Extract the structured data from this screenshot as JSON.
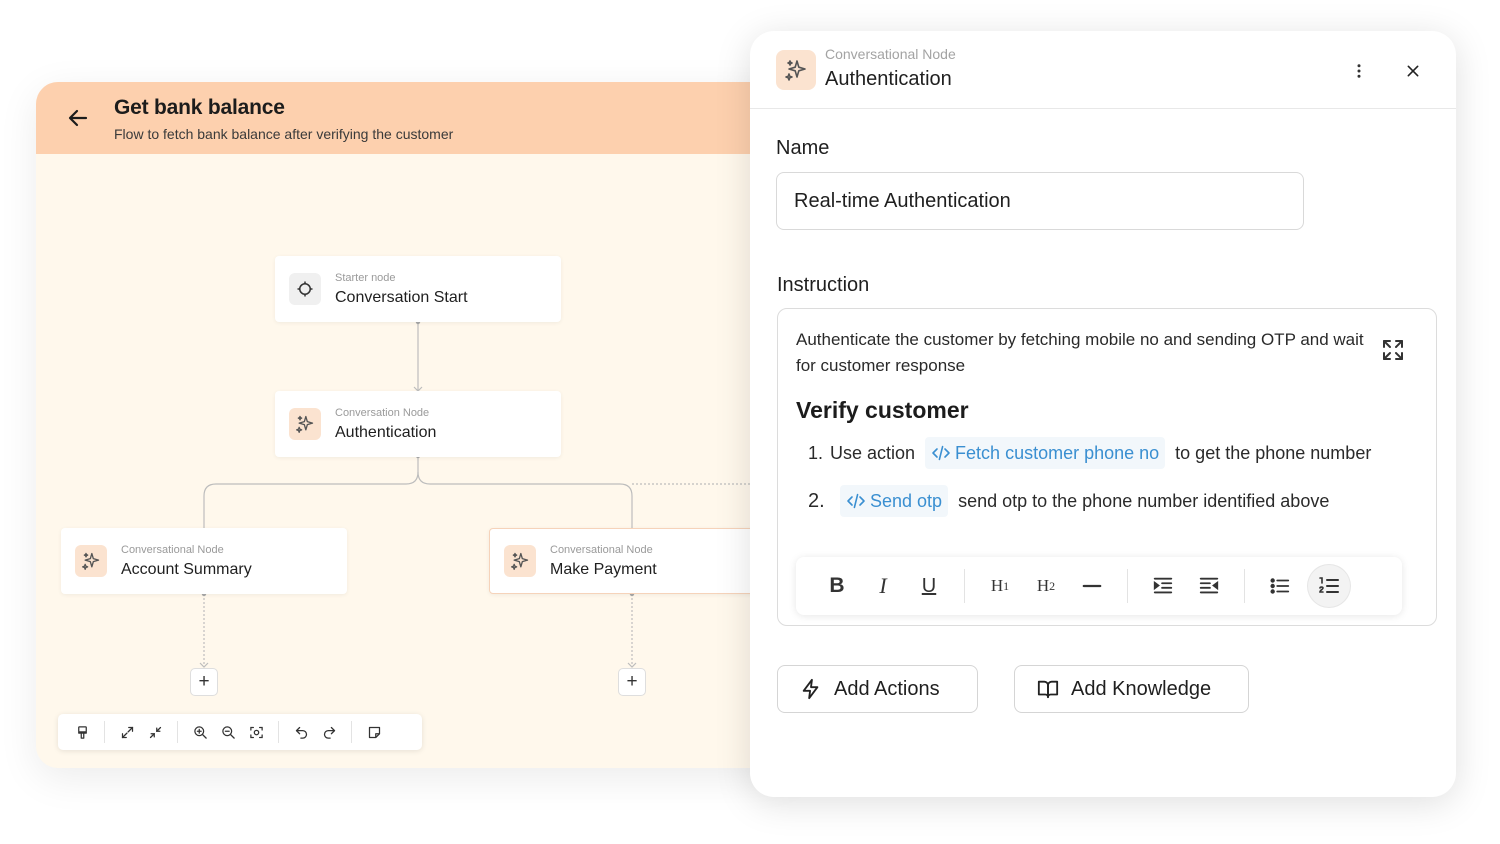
{
  "flow": {
    "title": "Get bank balance",
    "subtitle": "Flow to fetch bank balance after verifying the customer",
    "nodes": {
      "start": {
        "kind": "Starter node",
        "label": "Conversation Start"
      },
      "auth": {
        "kind": "Conversation Node",
        "label": "Authentication"
      },
      "summary": {
        "kind": "Conversational Node",
        "label": "Account Summary"
      },
      "payment": {
        "kind": "Conversational Node",
        "label": "Make Payment"
      }
    },
    "add_symbol": "+"
  },
  "panel": {
    "kind": "Conversational Node",
    "title": "Authentication",
    "name_label": "Name",
    "name_value": "Real-time Authentication",
    "instruction_label": "Instruction",
    "instruction_text": "Authenticate the customer by fetching mobile no and sending OTP and wait for customer response",
    "heading": "Verify customer",
    "steps": [
      {
        "num": "1.",
        "prefix": "Use action",
        "chip": "Fetch customer phone no",
        "suffix": "to get the phone number"
      },
      {
        "num": "2.",
        "prefix": "",
        "chip": "Send otp",
        "suffix": "send otp to the phone number identified above"
      }
    ],
    "toolbar": {
      "bold": "B",
      "italic": "I",
      "underline": "U",
      "h1": "H",
      "h1_sub": "1",
      "h2": "H",
      "h2_sub": "2"
    },
    "add_actions": "Add Actions",
    "add_knowledge": "Add Knowledge"
  },
  "colors": {
    "header_bg": "#fdd0ae",
    "canvas_bg": "#fff8ec",
    "accent_blue": "#3a8fd1",
    "node_icon_bg": "#fbe3d0"
  }
}
